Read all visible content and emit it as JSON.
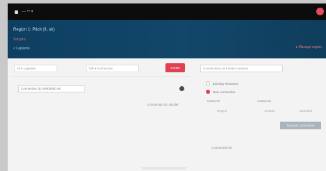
{
  "topbar": {
    "brand": "— •• ▾"
  },
  "header": {
    "title": "Region 1: Pitch (ft, ok)",
    "subtitle": "Sub pro",
    "crumb": "< Laplante",
    "link": "● Manage region"
  },
  "left": {
    "field1": "All  ▾  Laplante",
    "field2": "Tab  ▾  Connection",
    "apply_label": "Create",
    "list_value": "Connection (1) 00000000 ok",
    "link": "Connection ID: abcdef"
  },
  "right": {
    "field": "Connections on • Select Version",
    "radio1": "Existing Resource",
    "radio2": "New connection",
    "label_a": "Name ID",
    "label_b": "Instances",
    "val_a": "Region",
    "val_b": "Default",
    "val_c": "Standard",
    "action_label": "Request connection",
    "footer_link": "Connected OK"
  },
  "colors": {
    "accent": "#e0404f",
    "header": "#0d3f61"
  }
}
